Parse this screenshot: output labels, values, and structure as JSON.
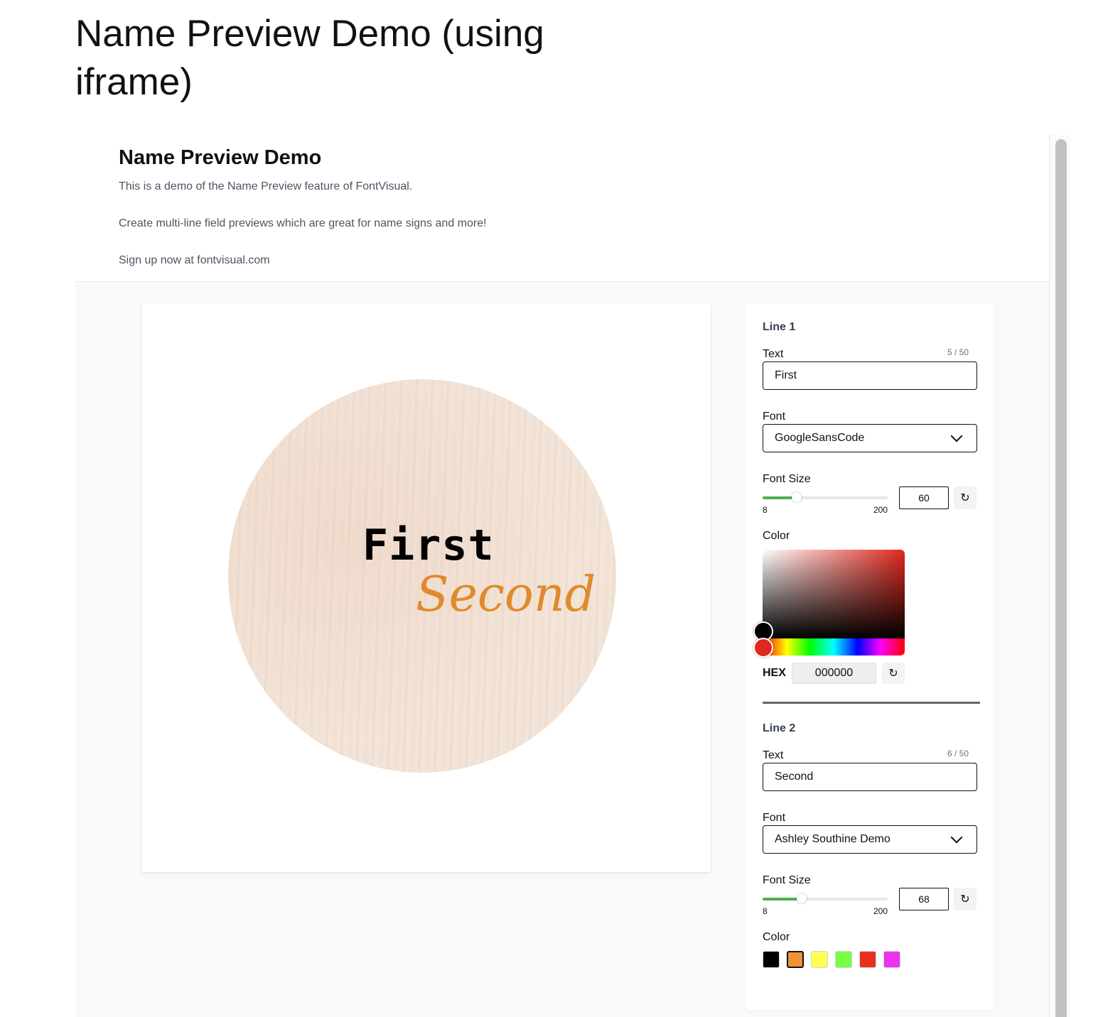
{
  "page": {
    "title": "Name Preview Demo (using iframe)"
  },
  "demo": {
    "title": "Name Preview Demo",
    "paragraphs": [
      "This is a demo of the Name Preview feature of FontVisual.",
      "Create multi-line field previews which are great for name signs and more!",
      "Sign up now at fontvisual.com"
    ]
  },
  "preview": {
    "line1": "First",
    "line2": "Second"
  },
  "panel": {
    "line1": {
      "heading": "Line 1",
      "text_label": "Text",
      "counter": "5 / 50",
      "text_value": "First",
      "font_label": "Font",
      "font_value": "GoogleSansCode",
      "size_label": "Font Size",
      "size_min": "8",
      "size_max": "200",
      "size_value": "60",
      "size_fraction": 0.27,
      "color_label": "Color",
      "hex_label": "HEX",
      "hex_value": "000000"
    },
    "line2": {
      "heading": "Line 2",
      "text_label": "Text",
      "counter": "6 / 50",
      "text_value": "Second",
      "font_label": "Font",
      "font_value": "Ashley Southine Demo",
      "size_label": "Font Size",
      "size_min": "8",
      "size_max": "200",
      "size_value": "68",
      "size_fraction": 0.31,
      "color_label": "Color",
      "swatches": [
        {
          "name": "black",
          "color": "#000000",
          "selected": false
        },
        {
          "name": "orange",
          "color": "#f0923a",
          "selected": true
        },
        {
          "name": "yellow",
          "color": "#ffff55",
          "selected": false
        },
        {
          "name": "green",
          "color": "#77ff44",
          "selected": false
        },
        {
          "name": "red",
          "color": "#e8301e",
          "selected": false
        },
        {
          "name": "magenta",
          "color": "#ee33ee",
          "selected": false
        }
      ]
    }
  },
  "icons": {
    "reset": "refresh-icon",
    "dropdown": "chevron-down-icon"
  }
}
